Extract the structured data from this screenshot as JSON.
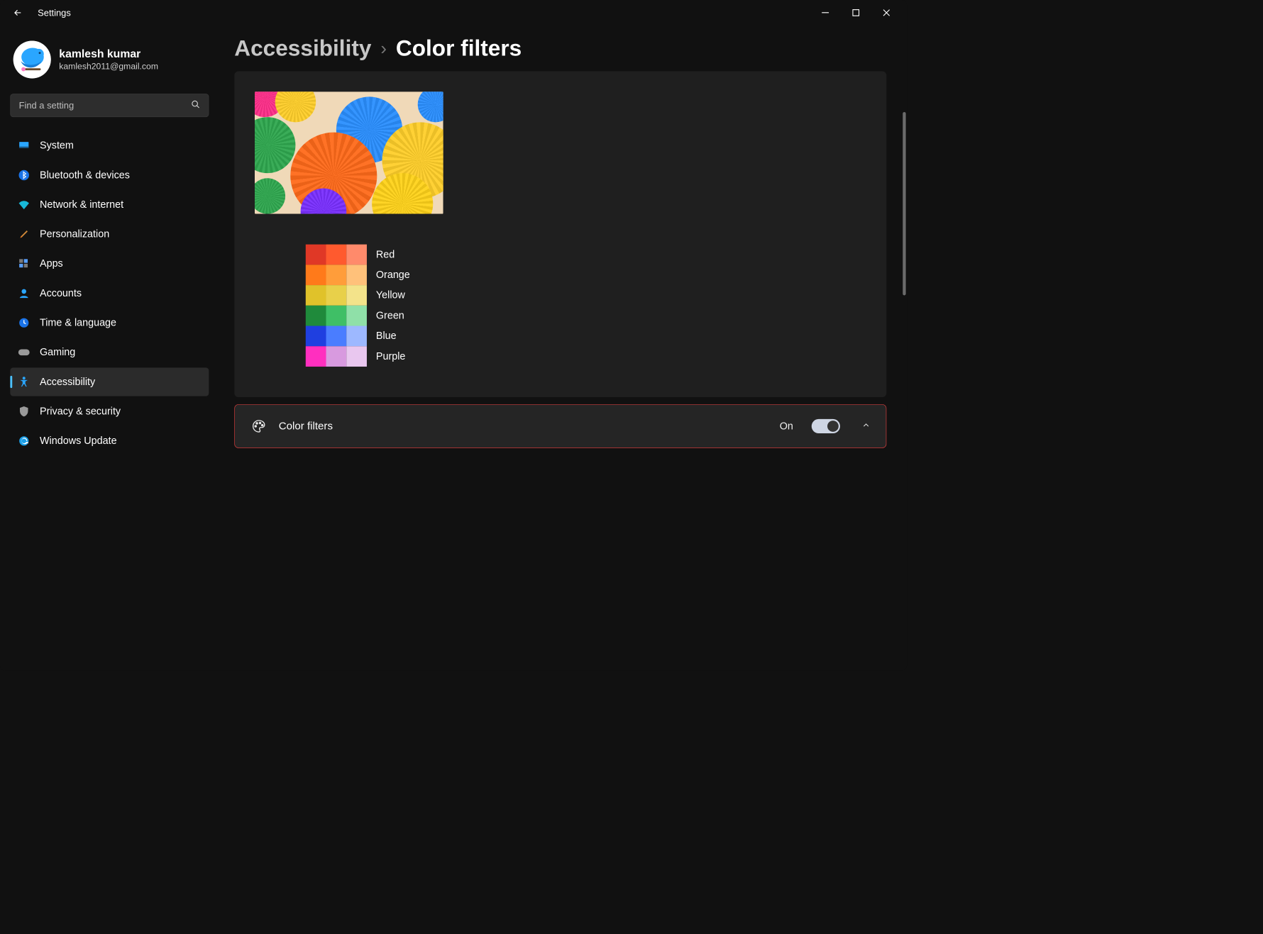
{
  "window": {
    "app_title": "Settings"
  },
  "user": {
    "name": "kamlesh kumar",
    "email": "kamlesh2011@gmail.com"
  },
  "search": {
    "placeholder": "Find a setting"
  },
  "nav": {
    "items": [
      {
        "label": "System"
      },
      {
        "label": "Bluetooth & devices"
      },
      {
        "label": "Network & internet"
      },
      {
        "label": "Personalization"
      },
      {
        "label": "Apps"
      },
      {
        "label": "Accounts"
      },
      {
        "label": "Time & language"
      },
      {
        "label": "Gaming"
      },
      {
        "label": "Accessibility"
      },
      {
        "label": "Privacy & security"
      },
      {
        "label": "Windows Update"
      }
    ]
  },
  "breadcrumb": {
    "parent": "Accessibility",
    "current": "Color filters"
  },
  "color_labels": [
    "Red",
    "Orange",
    "Yellow",
    "Green",
    "Blue",
    "Purple"
  ],
  "swatch_rows": [
    [
      "#e03826",
      "#ff5a2e",
      "#ff8a6b"
    ],
    [
      "#ff7a1a",
      "#ff9d3a",
      "#ffc17a"
    ],
    [
      "#e0c22a",
      "#e8d04a",
      "#f3e38a"
    ],
    [
      "#1f8a3b",
      "#3fbf66",
      "#8fe0a8"
    ],
    [
      "#1f3fe0",
      "#4a7dff",
      "#9db8ff"
    ],
    [
      "#ff2fbf",
      "#d89adf",
      "#e9c7ef"
    ]
  ],
  "setting_row": {
    "label": "Color filters",
    "state": "On"
  }
}
